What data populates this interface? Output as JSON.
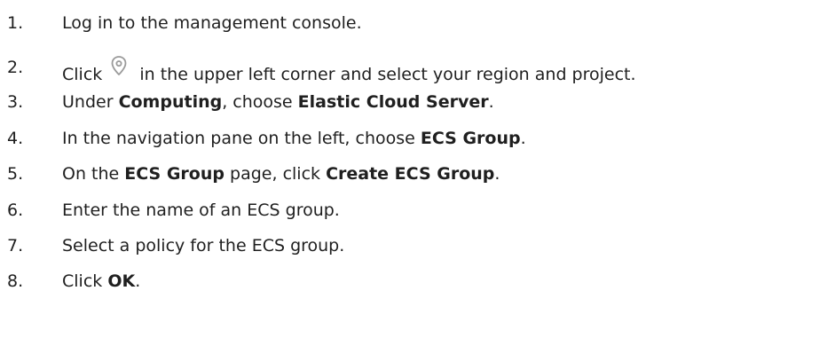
{
  "steps": [
    {
      "number": "1.",
      "parts": [
        {
          "text": "Log in to the management console."
        }
      ]
    },
    {
      "number": "2.",
      "parts": [
        {
          "text": "Click "
        },
        {
          "icon": "location-pin-icon"
        },
        {
          "text": " in the upper left corner and select your region and project."
        }
      ]
    },
    {
      "number": "3.",
      "parts": [
        {
          "text": "Under "
        },
        {
          "text": "Computing",
          "bold": true
        },
        {
          "text": ", choose "
        },
        {
          "text": "Elastic Cloud Server",
          "bold": true
        },
        {
          "text": "."
        }
      ]
    },
    {
      "number": "4.",
      "parts": [
        {
          "text": "In the navigation pane on the left, choose "
        },
        {
          "text": "ECS Group",
          "bold": true
        },
        {
          "text": "."
        }
      ]
    },
    {
      "number": "5.",
      "parts": [
        {
          "text": "On the "
        },
        {
          "text": "ECS Group",
          "bold": true
        },
        {
          "text": " page, click "
        },
        {
          "text": "Create ECS Group",
          "bold": true
        },
        {
          "text": "."
        }
      ]
    },
    {
      "number": "6.",
      "parts": [
        {
          "text": "Enter the name of an ECS group."
        }
      ]
    },
    {
      "number": "7.",
      "parts": [
        {
          "text": "Select a policy for the ECS group."
        }
      ]
    },
    {
      "number": "8.",
      "parts": [
        {
          "text": "Click "
        },
        {
          "text": "OK",
          "bold": true
        },
        {
          "text": "."
        }
      ]
    }
  ],
  "colors": {
    "text": "#1f1f1f",
    "icon": "#9a9a9a"
  }
}
